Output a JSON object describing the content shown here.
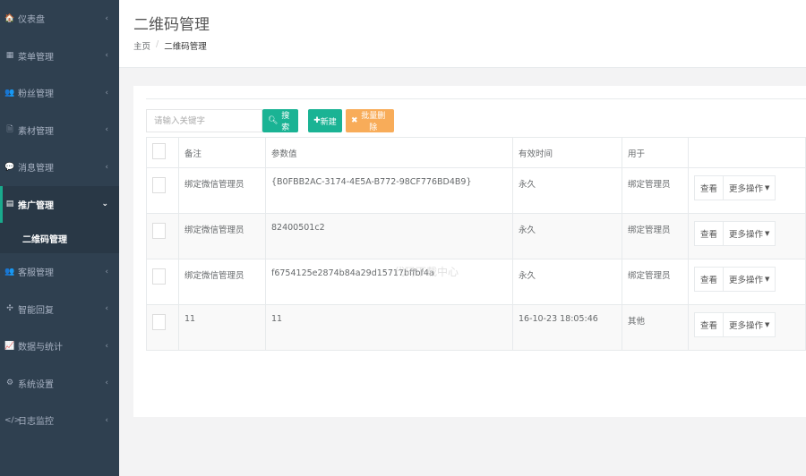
{
  "sidebar": {
    "items": [
      {
        "icon": "dashboard-icon",
        "glyph": "🏠",
        "label": "仪表盘"
      },
      {
        "icon": "menu-grid-icon",
        "glyph": "▦",
        "label": "菜单管理"
      },
      {
        "icon": "users-icon",
        "glyph": "👥",
        "label": "粉丝管理"
      },
      {
        "icon": "file-icon",
        "glyph": "🗎",
        "label": "素材管理"
      },
      {
        "icon": "message-icon",
        "glyph": "💬",
        "label": "消息管理"
      },
      {
        "icon": "promotion-icon",
        "glyph": "▤",
        "label": "推广管理"
      },
      {
        "icon": "service-icon",
        "glyph": "👥",
        "label": "客服管理"
      },
      {
        "icon": "robot-icon",
        "glyph": "✣",
        "label": "智能回复"
      },
      {
        "icon": "chart-icon",
        "glyph": "📈",
        "label": "数据与统计"
      },
      {
        "icon": "settings-icon",
        "glyph": "⚙",
        "label": "系统设置"
      },
      {
        "icon": "code-icon",
        "glyph": "</>",
        "label": "日志监控"
      }
    ],
    "sub_item": "二维码管理"
  },
  "header": {
    "title": "二维码管理",
    "breadcrumb_home": "主页",
    "breadcrumb_sep": "/",
    "breadcrumb_current": "二维码管理"
  },
  "toolbar": {
    "search_placeholder": "请输入关键字",
    "search_label": "搜索",
    "new_label": "新建",
    "batch_delete_label": "批量删除"
  },
  "table": {
    "headers": [
      "备注",
      "参数值",
      "有效时间",
      "用于"
    ],
    "rows": [
      {
        "remark": "绑定微信管理员",
        "param": "{B0FBB2AC-3174-4E5A-B772-98CF776BD4B9}",
        "valid": "永久",
        "usage": "绑定管理员"
      },
      {
        "remark": "绑定微信管理员",
        "param": "82400501c2",
        "valid": "永久",
        "usage": "绑定管理员"
      },
      {
        "remark": "绑定微信管理员",
        "param": "f6754125e2874b84a29d15717bffbf4a",
        "valid": "永久",
        "usage": "绑定管理员"
      },
      {
        "remark": "11",
        "param": "11",
        "valid": "16-10-23 18:05:46",
        "usage": "其他"
      }
    ],
    "view_label": "查看",
    "more_label": "更多操作"
  },
  "watermark": "代码下载中心",
  "colors": {
    "sidebar_bg": "#2f4050",
    "primary": "#1ab394",
    "warning": "#f8ac59"
  }
}
